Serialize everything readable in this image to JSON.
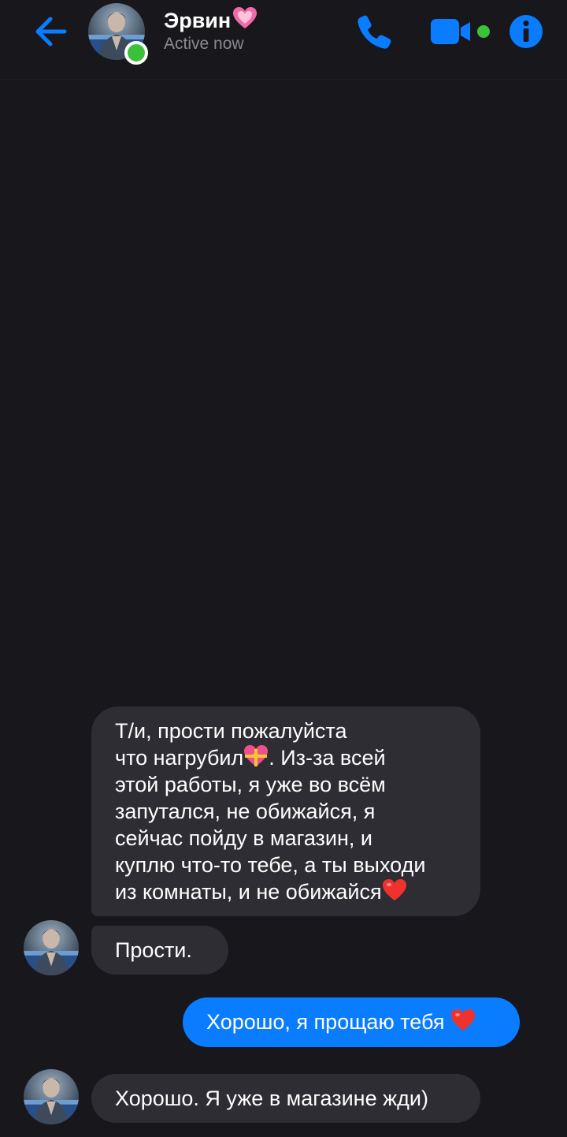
{
  "header": {
    "contact_name": "Эрвин",
    "status": "Active now",
    "icons": [
      "back-arrow-icon",
      "phone-icon",
      "video-camera-icon",
      "info-icon"
    ],
    "accent_color": "#0a7cff",
    "online_color": "#3cc13b"
  },
  "messages": [
    {
      "direction": "incoming",
      "lines": [
        "Т/и, прости пожалуйста",
        "что нагрубил",
        ". Из-за всей",
        "этой работы, я уже во всём",
        "запутался, не обижайся, я",
        "сейчас пойду в магазин, и",
        "куплю что-то тебе, а ты выходи",
        "из комнаты, и не обижайся"
      ]
    },
    {
      "direction": "incoming",
      "text": "Прости."
    },
    {
      "direction": "outgoing",
      "text": "Хорошо, я прощаю тебя"
    },
    {
      "direction": "incoming",
      "text": "Хорошо. Я уже в магазине жди)"
    }
  ],
  "colors": {
    "background": "#18171c",
    "incoming_bubble": "#2e2d33",
    "outgoing_bubble": "#0a7cff",
    "status_text": "#8a8a90"
  }
}
